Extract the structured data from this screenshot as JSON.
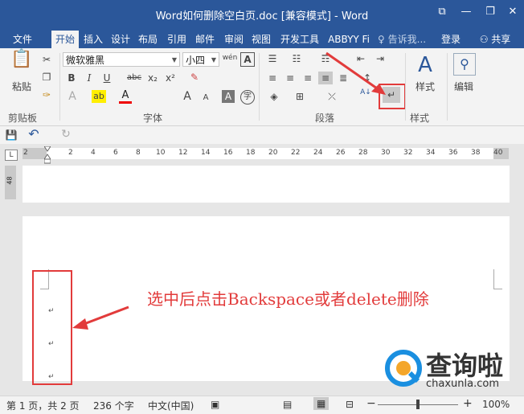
{
  "window": {
    "title": "Word如何删除空白页.doc [兼容模式] - Word",
    "help_glyph": "⧉",
    "min_glyph": "—",
    "restore_glyph": "❐",
    "close_glyph": "✕"
  },
  "tabs": [
    {
      "label": "文件"
    },
    {
      "label": "开始"
    },
    {
      "label": "插入"
    },
    {
      "label": "设计"
    },
    {
      "label": "布局"
    },
    {
      "label": "引用"
    },
    {
      "label": "邮件"
    },
    {
      "label": "审阅"
    },
    {
      "label": "视图"
    },
    {
      "label": "开发工具"
    },
    {
      "label": "ABBYY Fi"
    }
  ],
  "tell_me": "告诉我...",
  "signin": "登录",
  "share": "共享",
  "clipboard": {
    "paste": "粘贴",
    "group": "剪贴板"
  },
  "font": {
    "name": "微软雅黑",
    "size": "小四",
    "wen": "wén",
    "a_box": "A",
    "bold": "B",
    "italic": "I",
    "underline": "U",
    "strike": "abc",
    "sub": "x₂",
    "sup": "x²",
    "eraser": "✎",
    "text_effect": "A",
    "highlight": "ab",
    "font_color": "A",
    "grow": "A",
    "shrink": "A",
    "char_shade": "A",
    "enclose": "字",
    "group": "字体"
  },
  "paragraph": {
    "group": "段落",
    "pilcrow": "↵",
    "sort": "A↓"
  },
  "styles": {
    "label": "样式",
    "group": "样式"
  },
  "editing": {
    "label": "编辑"
  },
  "qat": {
    "save": "💾",
    "undo": "↶",
    "redo": "↻"
  },
  "ruler": {
    "numbers": [
      "2",
      "2",
      "4",
      "6",
      "8",
      "10",
      "12",
      "14",
      "16",
      "18",
      "20",
      "22",
      "24",
      "26",
      "28",
      "30",
      "32",
      "34",
      "36",
      "38",
      "40"
    ],
    "vnum": "48"
  },
  "document": {
    "marks": [
      "↵",
      "↵",
      "↵"
    ],
    "instruction": "选中后点击Backspace或者delete删除"
  },
  "status": {
    "page": "第 1 页，共 2 页",
    "words": "236 个字",
    "lang": "中文(中国)",
    "zoom": "100%",
    "minus": "−",
    "plus": "+"
  },
  "watermark": {
    "cn": "查询啦",
    "url": "chaxunla.com"
  },
  "colors": {
    "accent": "#2b579a",
    "annotation": "#e23b3b"
  }
}
